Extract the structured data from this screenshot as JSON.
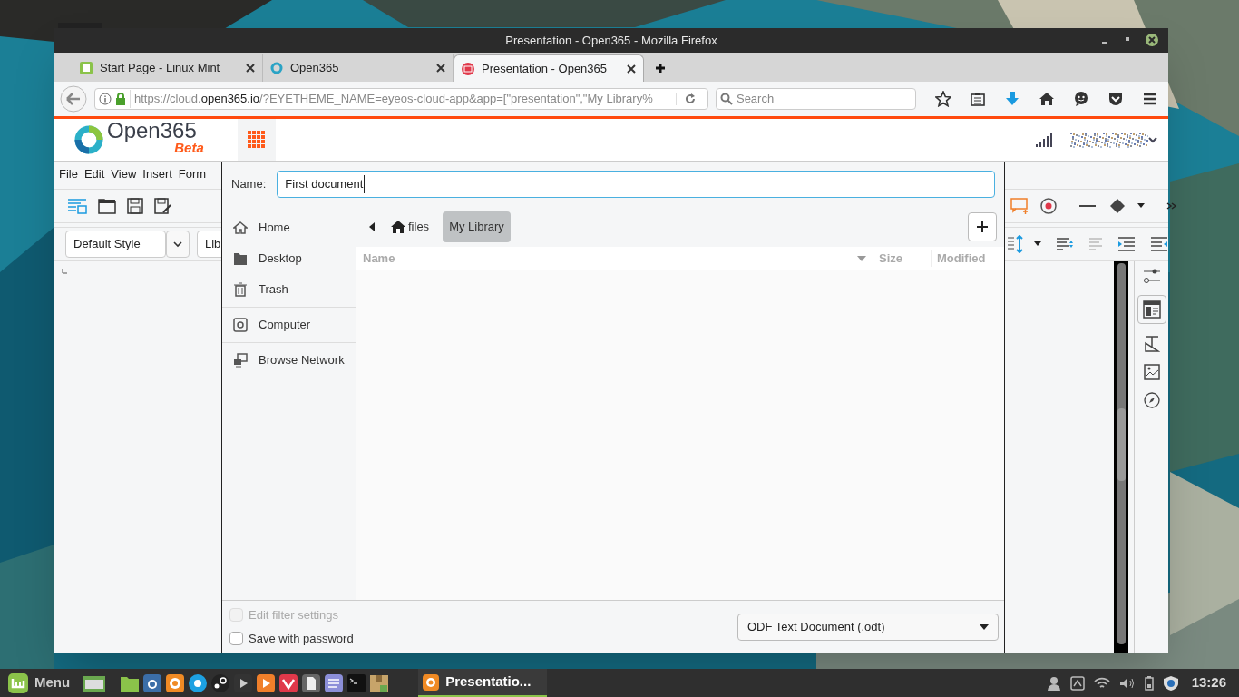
{
  "window": {
    "title": "Presentation - Open365 - Mozilla Firefox"
  },
  "tabs": [
    {
      "label": "Start Page - Linux Mint",
      "selected": false,
      "kind": "mint"
    },
    {
      "label": "Open365",
      "selected": false,
      "kind": "ring"
    },
    {
      "label": "Presentation - Open365",
      "selected": true,
      "kind": "slides"
    }
  ],
  "address_bar": {
    "url_start": "https://cloud.",
    "url_domain": "open365.io",
    "url_rest": "/?EYETHEME_NAME=eyeos-cloud-app&app=[\"presentation\",\"My Library%"
  },
  "search": {
    "placeholder": "Search"
  },
  "app_header": {
    "logo": "Open365",
    "badge": "Beta"
  },
  "menu": [
    "File",
    "Edit",
    "View",
    "Insert",
    "Form"
  ],
  "style_box": {
    "value": "Default Style"
  },
  "font_box": {
    "value": "Lib"
  },
  "dialog": {
    "name_label": "Name:",
    "name_value": "First document",
    "places": [
      [
        {
          "label": "Home",
          "kind": "home"
        },
        {
          "label": "Desktop",
          "kind": "folder"
        },
        {
          "label": "Trash",
          "kind": "trash"
        }
      ],
      [
        {
          "label": "Computer",
          "kind": "drive"
        }
      ],
      [
        {
          "label": "Browse Network",
          "kind": "network"
        }
      ]
    ],
    "breadcrumb": [
      {
        "label": "files",
        "selected": false,
        "kind": "home"
      },
      {
        "label": "My Library",
        "selected": true
      }
    ],
    "columns": [
      "Name",
      "Size",
      "Modified"
    ],
    "options": [
      {
        "label": "Edit filter settings",
        "checked": false,
        "disabled": true
      },
      {
        "label": "Save with password",
        "checked": false,
        "disabled": false
      }
    ],
    "file_type": "ODF Text Document (.odt)"
  },
  "taskbar": {
    "menu_label": "Menu",
    "window_label": "Presentatio...",
    "clock": "13:26"
  }
}
